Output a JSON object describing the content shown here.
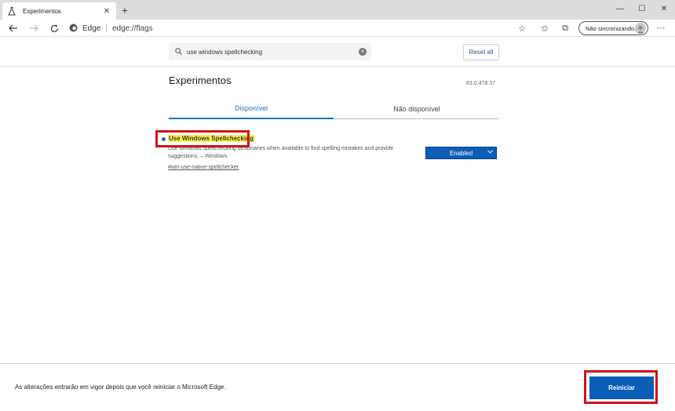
{
  "tab": {
    "title": "Experimentos",
    "close": "✕"
  },
  "window": {
    "minimize": "—",
    "maximize": "☐",
    "close": "✕",
    "new_tab": "+"
  },
  "address": {
    "site": "Edge",
    "separator": "|",
    "url": "edge://flags"
  },
  "profile": {
    "label": "Não sincronizando"
  },
  "toolbar": {
    "more": "···"
  },
  "search": {
    "query": "use windows spellchecking"
  },
  "reset": {
    "label": "Reset all"
  },
  "page": {
    "title": "Experimentos",
    "version": "83.0.478.37"
  },
  "tabs": [
    {
      "label": "Disponível"
    },
    {
      "label": "Não disponível"
    }
  ],
  "experiment": {
    "title": "Use Windows Spellchecking",
    "description": "Use Windows spellchecking dictionaries when available to find spelling mistakes and provide suggestions. – Windows",
    "link": "#win-use-native-spellchecker",
    "selected": "Enabled"
  },
  "footer": {
    "message": "As alterações entrarão em vigor depois que você reiniciar o Microsoft Edge.",
    "restart": "Reiniciar"
  },
  "colors": {
    "accent": "#0b5eb7",
    "highlight": "#fff34a",
    "annotation": "#d0131b"
  }
}
